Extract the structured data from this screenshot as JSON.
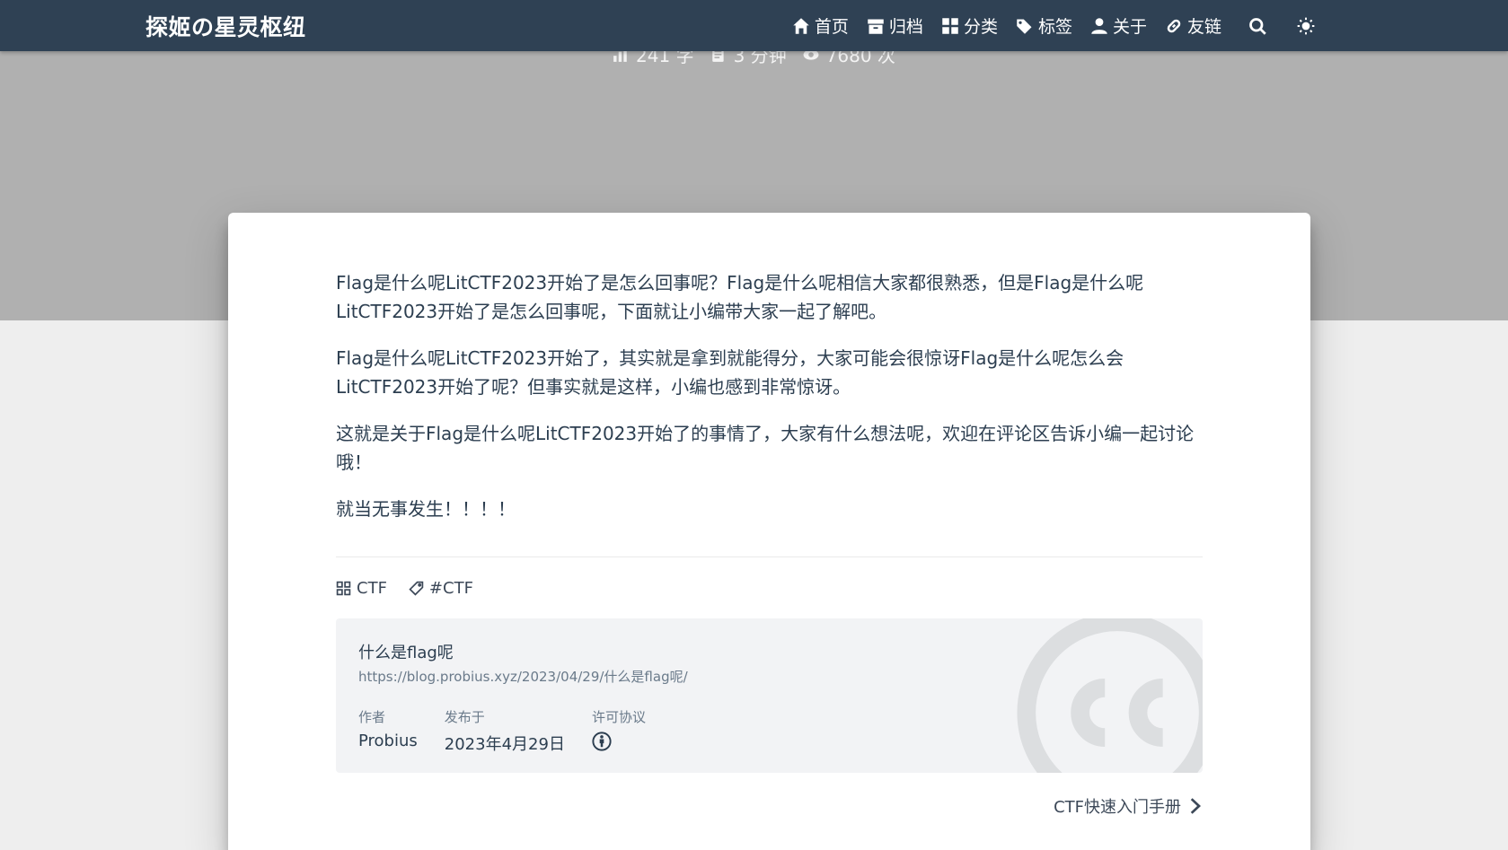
{
  "site": {
    "brand": "探姬の星灵枢纽"
  },
  "nav": {
    "items": [
      {
        "label": "首页",
        "icon": "home-icon"
      },
      {
        "label": "归档",
        "icon": "archive-icon"
      },
      {
        "label": "分类",
        "icon": "category-icon"
      },
      {
        "label": "标签",
        "icon": "tags-icon"
      },
      {
        "label": "关于",
        "icon": "user-icon"
      },
      {
        "label": "友链",
        "icon": "link-icon"
      }
    ],
    "search_icon": "search-icon",
    "theme_icon": "sun-icon"
  },
  "post_meta": {
    "words": "241 字",
    "reading_time": "3 分钟",
    "views": "7680 次"
  },
  "article": {
    "paragraphs": [
      "Flag是什么呢LitCTF2023开始了是怎么回事呢？Flag是什么呢相信大家都很熟悉，但是Flag是什么呢LitCTF2023开始了是怎么回事呢，下面就让小编带大家一起了解吧。",
      "Flag是什么呢LitCTF2023开始了，其实就是拿到就能得分，大家可能会很惊讶Flag是什么呢怎么会LitCTF2023开始了呢？但事实就是这样，小编也感到非常惊讶。",
      "这就是关于Flag是什么呢LitCTF2023开始了的事情了，大家有什么想法呢，欢迎在评论区告诉小编一起讨论哦！",
      "就当无事发生！！！！"
    ]
  },
  "tags": {
    "category": "CTF",
    "tag": "#CTF"
  },
  "license": {
    "title": "什么是flag呢",
    "url": "https://blog.probius.xyz/2023/04/29/什么是flag呢/",
    "author_label": "作者",
    "author": "Probius",
    "published_label": "发布于",
    "published": "2023年4月29日",
    "license_label": "许可协议",
    "license_icon": "cc-by-icon"
  },
  "next_post": {
    "label": "CTF快速入门手册"
  }
}
